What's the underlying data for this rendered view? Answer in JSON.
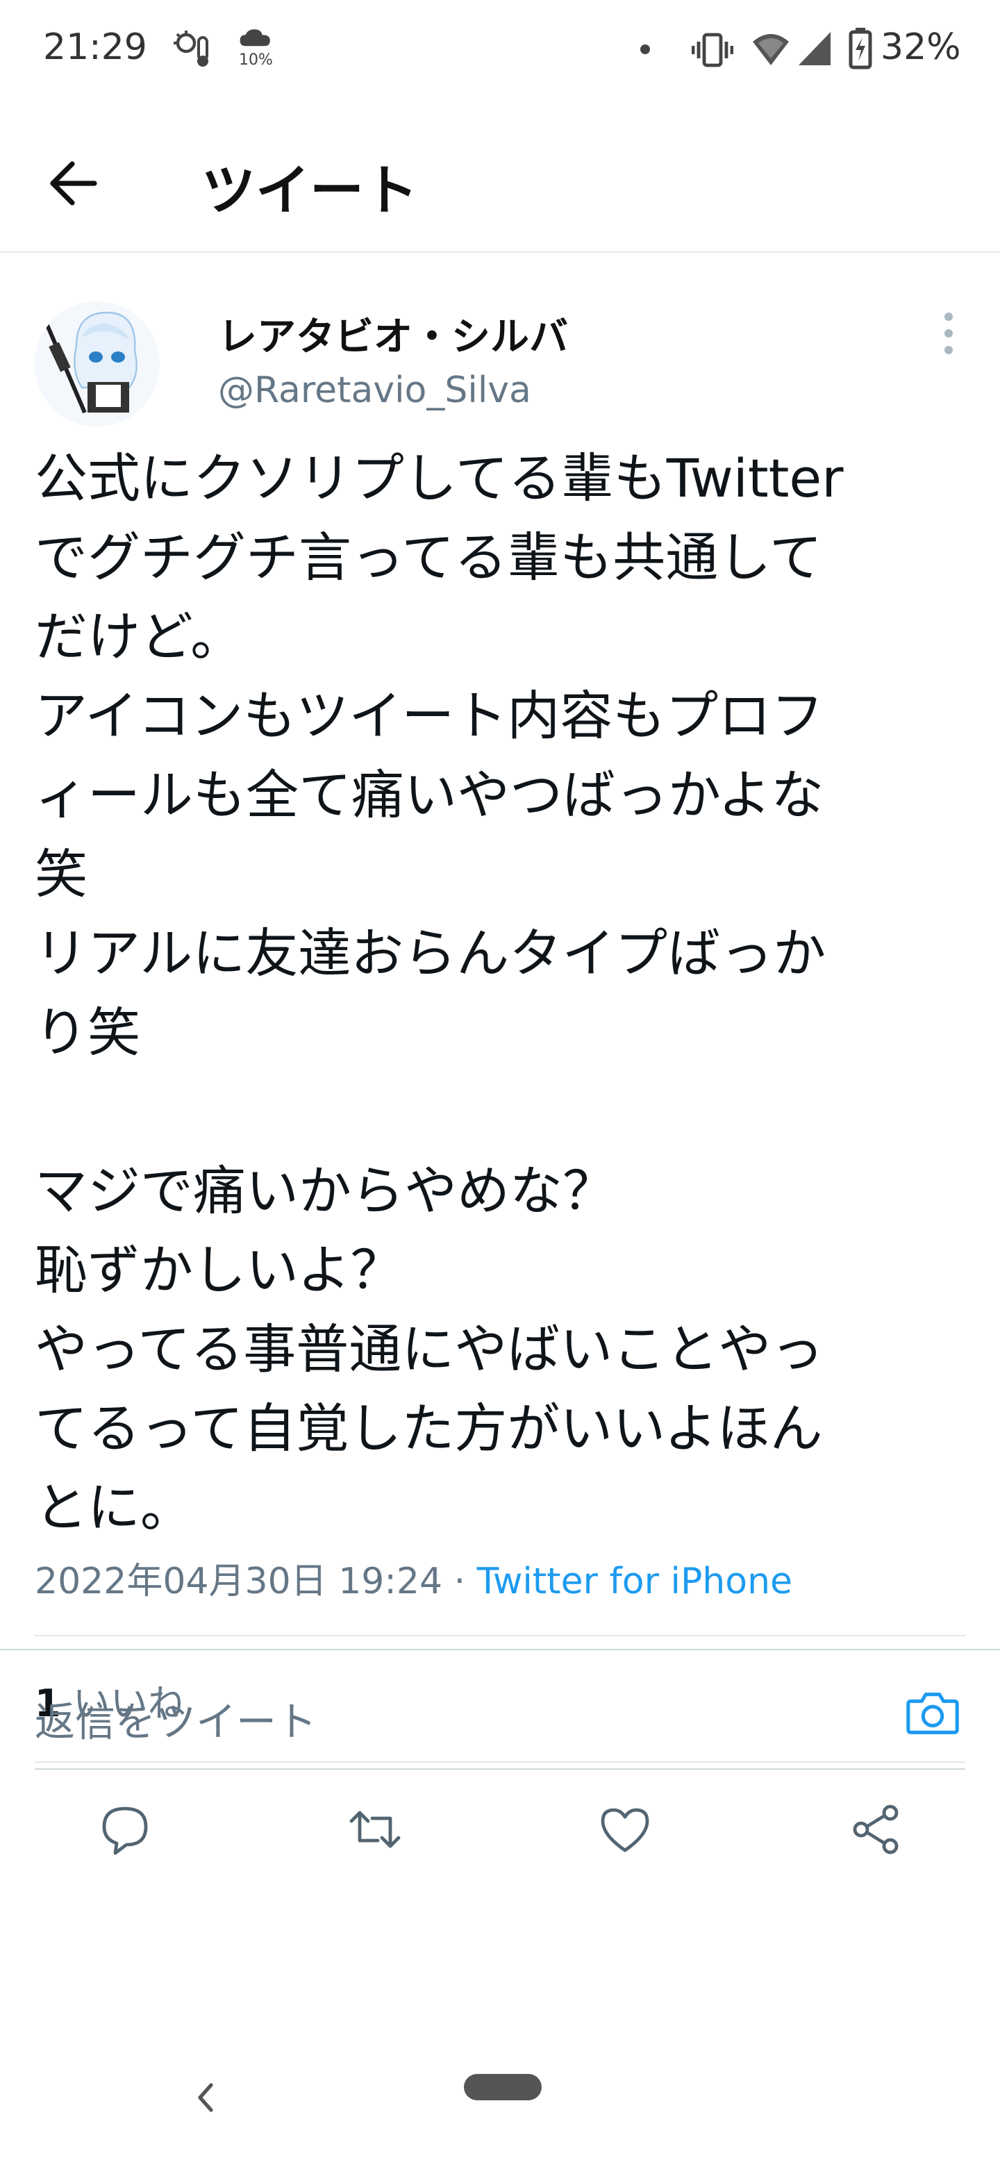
{
  "status_bar": {
    "time": "21:29",
    "rain_pct": "10%",
    "battery": "32%",
    "icons": [
      "weather-icon",
      "cloud-rain-icon",
      "notification-dot-icon",
      "vibrate-icon",
      "wifi-icon",
      "signal-icon",
      "battery-charging-icon"
    ]
  },
  "header": {
    "title": "ツイート",
    "back_icon": "arrow-left-icon"
  },
  "tweet": {
    "display_name": "レアタビオ・シルバ",
    "handle": "@Raretavio_Silva",
    "text": "公式にクソリプしてる輩もTwitter\nでグチグチ言ってる輩も共通して\nだけど。\nアイコンもツイート内容もプロフ\nィールも全て痛いやつばっかよな\n笑\nリアルに友達おらんタイプばっか\nり笑\n\nマジで痛いからやめな？\n恥ずかしいよ？\nやってる事普通にやばいことやっ\nてるって自覚した方がいいよほん\nとに。",
    "timestamp": "2022年04月30日 19:24",
    "separator": " · ",
    "source": "Twitter for iPhone",
    "likes_count": "1",
    "likes_label": " いいね"
  },
  "actions": {
    "icons": [
      "reply-icon",
      "retweet-icon",
      "like-icon",
      "share-icon"
    ]
  },
  "reply_bar": {
    "placeholder": "返信をツイート",
    "camera_icon": "camera-icon"
  },
  "colors": {
    "accent": "#1d9bf0",
    "secondary_text": "#657786",
    "primary_text": "#0f1419",
    "divider": "#e1e8ed"
  }
}
